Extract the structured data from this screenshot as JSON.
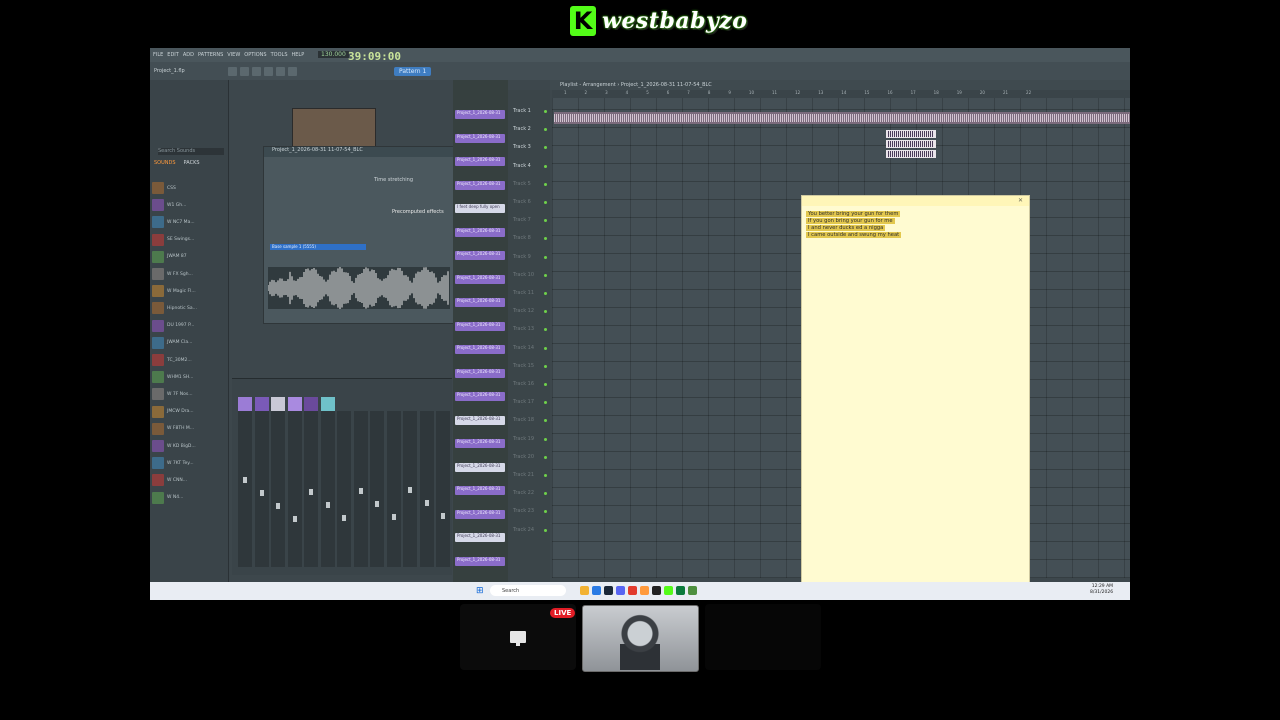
{
  "stream": {
    "channel_name": "westbabyzo",
    "logo_letter": "K",
    "live_label": "LIVE"
  },
  "fl": {
    "menu": [
      "FILE",
      "EDIT",
      "ADD",
      "PATTERNS",
      "VIEW",
      "OPTIONS",
      "TOOLS",
      "HELP"
    ],
    "time": "39:09",
    "time_sub": "00",
    "tempo": "130.000",
    "pattern": "Pattern 1",
    "project_name": "Project_1.flp",
    "playlist_title": "Playlist - Arrangement › Project_1_2026-08-31 11-07-54_BLC",
    "browser_tabs": [
      "SOUNDS",
      "PACKS"
    ],
    "browser_search_placeholder": "Search Sounds",
    "browser_items": [
      "CSS",
      "W1 Gh...",
      "W NC7 Ma...",
      "SE Swings...",
      "JWAM 87",
      "W FX Sgh...",
      "W Magic Fl...",
      "Hipnotic Sa...",
      "DU 1997 P...",
      "JWAM Cla...",
      "TC_30M2...",
      "WHM1 SH...",
      "W 7F Nos...",
      "JMCW Dra...",
      "W F8TH M...",
      "W KD BigD...",
      "W 7KT Tey...",
      "W CNN...",
      "W N4..."
    ],
    "tracks": [
      "Track 1",
      "Track 2",
      "Track 3",
      "Track 4",
      "Track 5",
      "Track 6",
      "Track 7",
      "Track 8",
      "Track 9",
      "Track 10",
      "Track 11",
      "Track 12",
      "Track 13",
      "Track 14",
      "Track 15",
      "Track 16",
      "Track 17",
      "Track 18",
      "Track 19",
      "Track 20",
      "Track 21",
      "Track 22",
      "Track 23",
      "Track 24"
    ],
    "clips": [
      "Project_1_2026-08-31",
      "Project_1_2026-08-31",
      "Project_1_2026-08-31",
      "Project_1_2026-08-31",
      "I feet deep fully open",
      "Project_1_2026-08-31",
      "Project_1_2026-08-31",
      "Project_1_2026-08-31",
      "Project_1_2026-08-31",
      "Project_1_2026-08-31",
      "Project_1_2026-08-31",
      "Project_1_2026-08-31",
      "Project_1_2026-08-31",
      "Project_1_2026-08-31",
      "Project_1_2026-08-31",
      "Project_1_2026-08-31",
      "Project_1_2026-08-31",
      "Project_1_2026-08-31",
      "Project_1_2026-08-31",
      "Project_1_2026-08-31"
    ],
    "sample_window": {
      "title": "Project_1_2026-08-31 11-07-54_BLC",
      "selected_item": "Base sample 1 (5555)",
      "time_stretching_label": "Time stretching",
      "precomputed_label": "Precomputed effects"
    }
  },
  "notepad": {
    "lines": [
      "You better bring your gun for them",
      "If you gon bring your gun for me",
      "I and never ducks ed a nigga",
      "I came outside and swung my heat"
    ]
  },
  "taskbar": {
    "search_placeholder": "Search",
    "clock_time": "12:29 AM",
    "clock_date": "8/31/2026"
  }
}
